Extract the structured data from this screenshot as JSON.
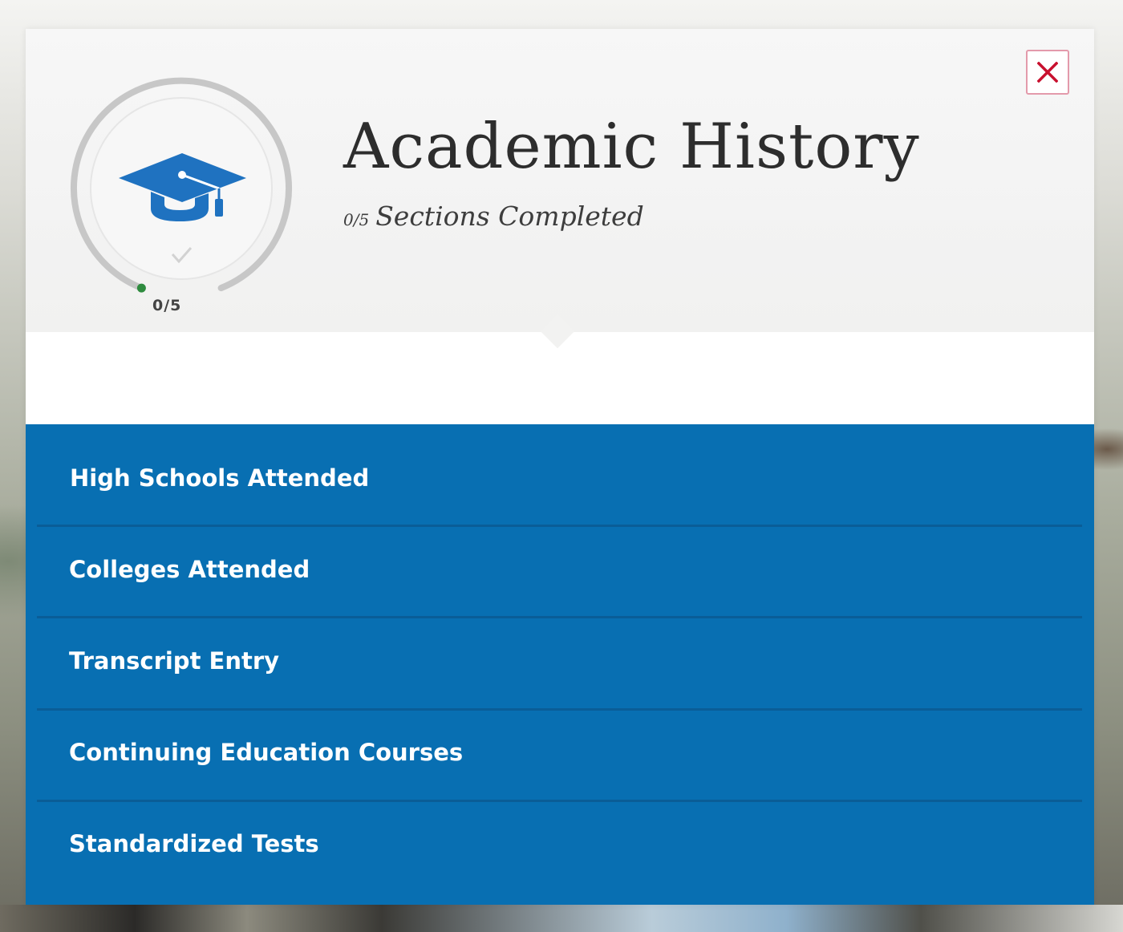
{
  "modal": {
    "title": "Academic History",
    "progress": {
      "completed": 0,
      "total": 5,
      "count_text": "0/5",
      "label": "Sections Completed"
    },
    "dial": {
      "count_text": "0/5",
      "icon": "graduation-cap-icon",
      "check_icon": "checkmark-icon"
    },
    "close_icon": "close-icon",
    "sections": [
      {
        "label": "High Schools Attended"
      },
      {
        "label": "Colleges Attended"
      },
      {
        "label": "Transcript Entry"
      },
      {
        "label": "Continuing Education Courses"
      },
      {
        "label": "Standardized Tests"
      }
    ]
  },
  "colors": {
    "section_background": "#086fb2",
    "section_divider": "#0a5d97",
    "icon_blue": "#1f72c0",
    "close_accent": "#c8102e",
    "progress_dot": "#2e8b3e"
  }
}
